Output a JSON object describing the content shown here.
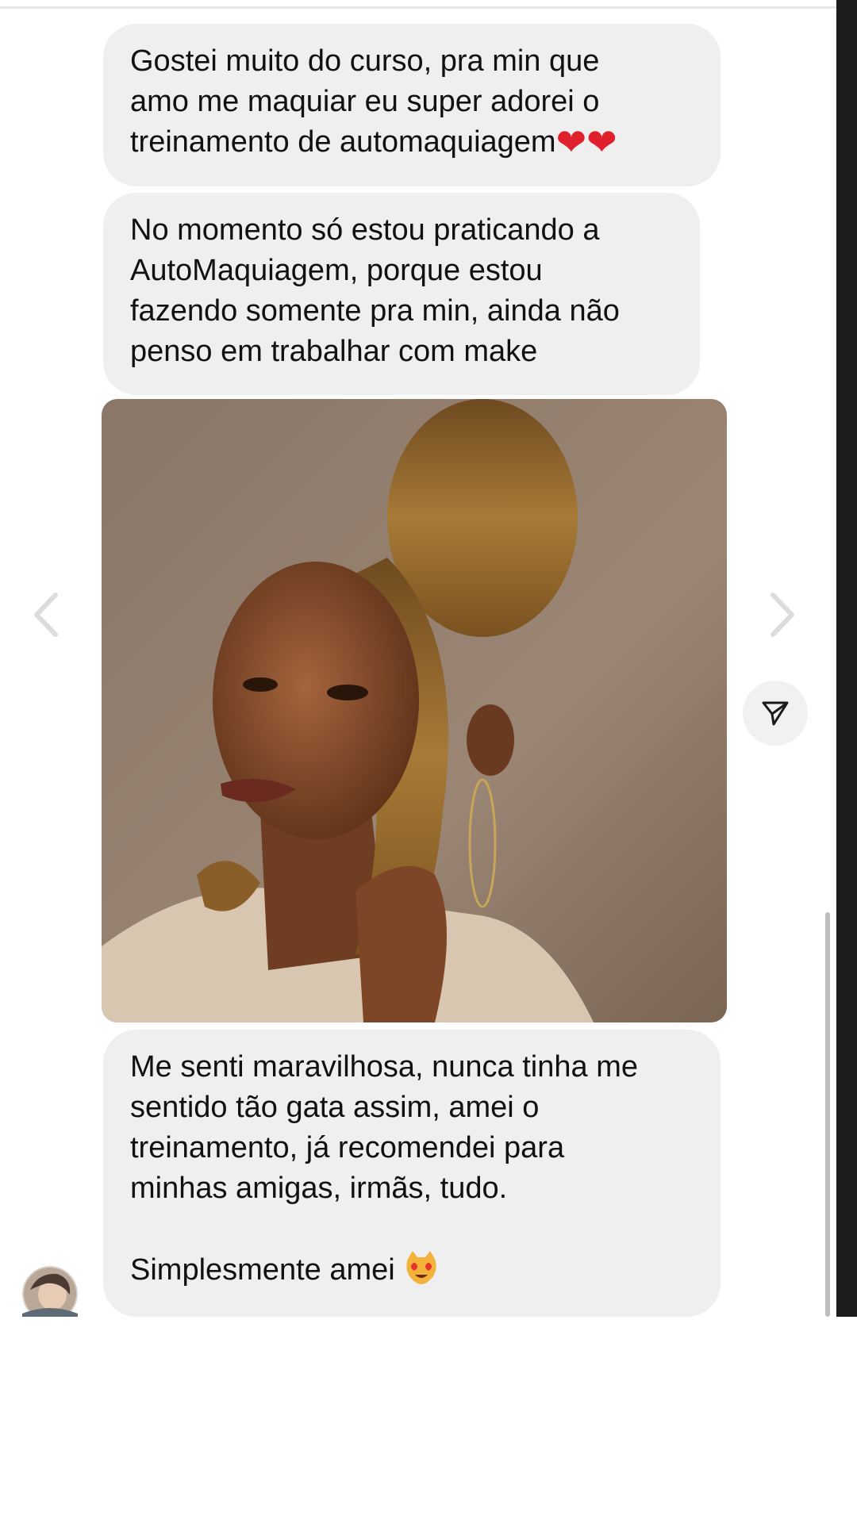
{
  "messages": [
    {
      "text": "Gostei muito do curso, pra min que\namo me maquiar eu super adorei o\ntreinamento de automaquiagem",
      "emoji": "heart-emoji"
    },
    {
      "text": "No momento só estou praticando a\nAutoMaquiagem, porque estou\nfazendo somente pra min, ainda não\npenso em trabalhar com make"
    },
    {
      "text": "Me senti maravilhosa, nunca tinha me\nsentido tão gata assim, amei o\ntreinamento, já recomendei para\nminhas amigas, irmãs, tudo.\n\nSimplesmente amei",
      "emoji": "heart-eyes-cat-emoji"
    }
  ],
  "hearts": "❤️❤️",
  "icons": {
    "prev": "chevron-left-icon",
    "next": "chevron-right-icon",
    "share": "send-icon"
  },
  "colors": {
    "bubble": "#efefef",
    "text": "#111111",
    "heart": "#e0202b"
  }
}
